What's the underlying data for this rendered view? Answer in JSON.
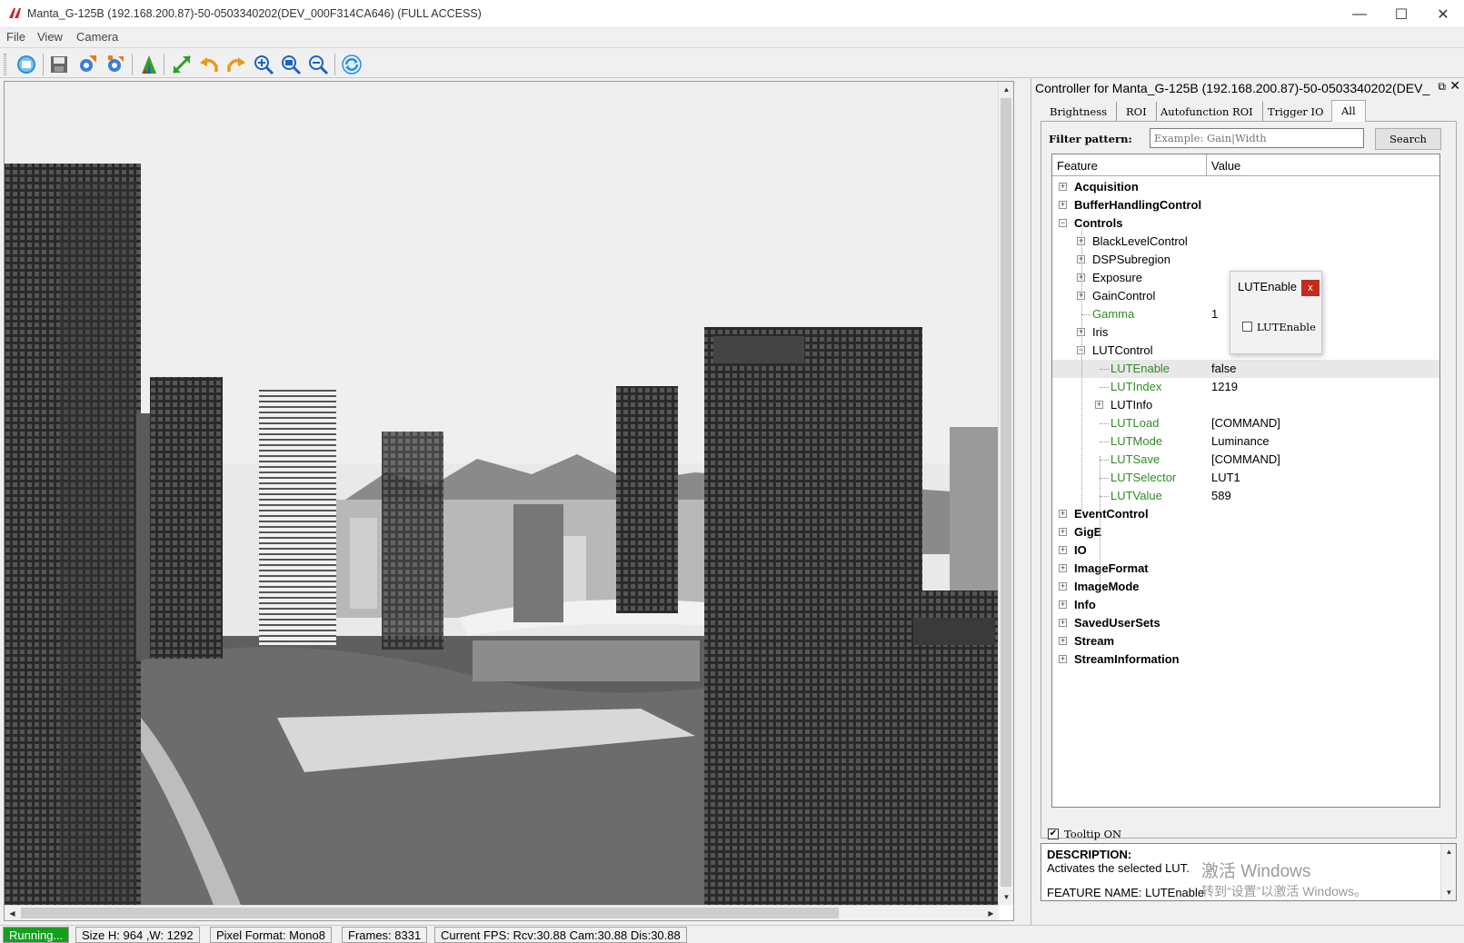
{
  "window": {
    "title": "Manta_G-125B (192.168.200.87)-50-0503340202(DEV_000F314CA646) (FULL ACCESS)",
    "minimize": "—",
    "maximize": "☐",
    "close": "✕"
  },
  "menu": [
    "File",
    "View",
    "Camera"
  ],
  "toolbar": {
    "icons": [
      "stop-acquisition-icon",
      "save-image-icon",
      "settings-load-icon",
      "settings-save-icon",
      "histogram-icon",
      "fit-window-icon",
      "rotate-left-icon",
      "rotate-right-icon",
      "zoom-in-icon",
      "zoom-fit-icon",
      "zoom-out-icon",
      "refresh-icon"
    ]
  },
  "controller": {
    "title": "Controller for Manta_G-125B (192.168.200.87)-50-0503340202(DEV_",
    "float_glyph": "⧉",
    "close_glyph": "✕",
    "tabs": [
      "Brightness",
      "ROI",
      "Autofunction ROI",
      "Trigger IO",
      "All"
    ],
    "filter_label": "Filter pattern:",
    "filter_placeholder": "Example: Gain|Width",
    "search_label": "Search",
    "columns": [
      "Feature",
      "Value"
    ],
    "tree": [
      {
        "label": "Acquisition",
        "level": 0,
        "expander": "+",
        "value": ""
      },
      {
        "label": "BufferHandlingControl",
        "level": 0,
        "expander": "+",
        "value": ""
      },
      {
        "label": "Controls",
        "level": 0,
        "expander": "−",
        "value": ""
      },
      {
        "label": "BlackLevelControl",
        "level": 1,
        "expander": "+",
        "value": ""
      },
      {
        "label": "DSPSubregion",
        "level": 1,
        "expander": "+",
        "value": ""
      },
      {
        "label": "Exposure",
        "level": 1,
        "expander": "+",
        "value": ""
      },
      {
        "label": "GainControl",
        "level": 1,
        "expander": "+",
        "value": ""
      },
      {
        "label": "Gamma",
        "level": 1,
        "expander": "",
        "value": "1"
      },
      {
        "label": "Iris",
        "level": 1,
        "expander": "+",
        "value": ""
      },
      {
        "label": "LUTControl",
        "level": 1,
        "expander": "−",
        "value": ""
      },
      {
        "label": "LUTEnable",
        "level": 2,
        "expander": "",
        "value": "false"
      },
      {
        "label": "LUTIndex",
        "level": 2,
        "expander": "",
        "value": "1219"
      },
      {
        "label": "LUTInfo",
        "level": 2,
        "expander": "+",
        "value": ""
      },
      {
        "label": "LUTLoad",
        "level": 2,
        "expander": "",
        "value": "[COMMAND]"
      },
      {
        "label": "LUTMode",
        "level": 2,
        "expander": "",
        "value": "Luminance"
      },
      {
        "label": "LUTSave",
        "level": 2,
        "expander": "",
        "value": "[COMMAND]"
      },
      {
        "label": "LUTSelector",
        "level": 2,
        "expander": "",
        "value": "LUT1"
      },
      {
        "label": "LUTValue",
        "level": 2,
        "expander": "",
        "value": "589"
      },
      {
        "label": "EventControl",
        "level": 0,
        "expander": "+",
        "value": ""
      },
      {
        "label": "GigE",
        "level": 0,
        "expander": "+",
        "value": ""
      },
      {
        "label": "IO",
        "level": 0,
        "expander": "+",
        "value": ""
      },
      {
        "label": "ImageFormat",
        "level": 0,
        "expander": "+",
        "value": ""
      },
      {
        "label": "ImageMode",
        "level": 0,
        "expander": "+",
        "value": ""
      },
      {
        "label": "Info",
        "level": 0,
        "expander": "+",
        "value": ""
      },
      {
        "label": "SavedUserSets",
        "level": 0,
        "expander": "+",
        "value": ""
      },
      {
        "label": "Stream",
        "level": 0,
        "expander": "+",
        "value": ""
      },
      {
        "label": "StreamInformation",
        "level": 0,
        "expander": "+",
        "value": ""
      }
    ],
    "tooltip_label": "Tooltip ON",
    "tooltip_checked": "✔",
    "description_head": "DESCRIPTION:",
    "description_text": "Activates the selected LUT.",
    "feature_name": "FEATURE NAME: LUTEnable"
  },
  "popup": {
    "title": "LUTEnable",
    "close": "x",
    "checkbox_label": "LUTEnable"
  },
  "watermark": {
    "line1": "激活 Windows",
    "line2": "转到“设置”以激活 Windows。"
  },
  "status": {
    "running": "Running...",
    "size": "Size H: 964 ,W: 1292",
    "pixel_format": "Pixel Format: Mono8",
    "frames": "Frames: 8331",
    "fps": "Current FPS: Rcv:30.88 Cam:30.88 Dis:30.88"
  },
  "colors": {
    "running_bg": "#14a01e",
    "leaf_feature": "#2e8b22",
    "popup_close": "#c42b1c"
  }
}
